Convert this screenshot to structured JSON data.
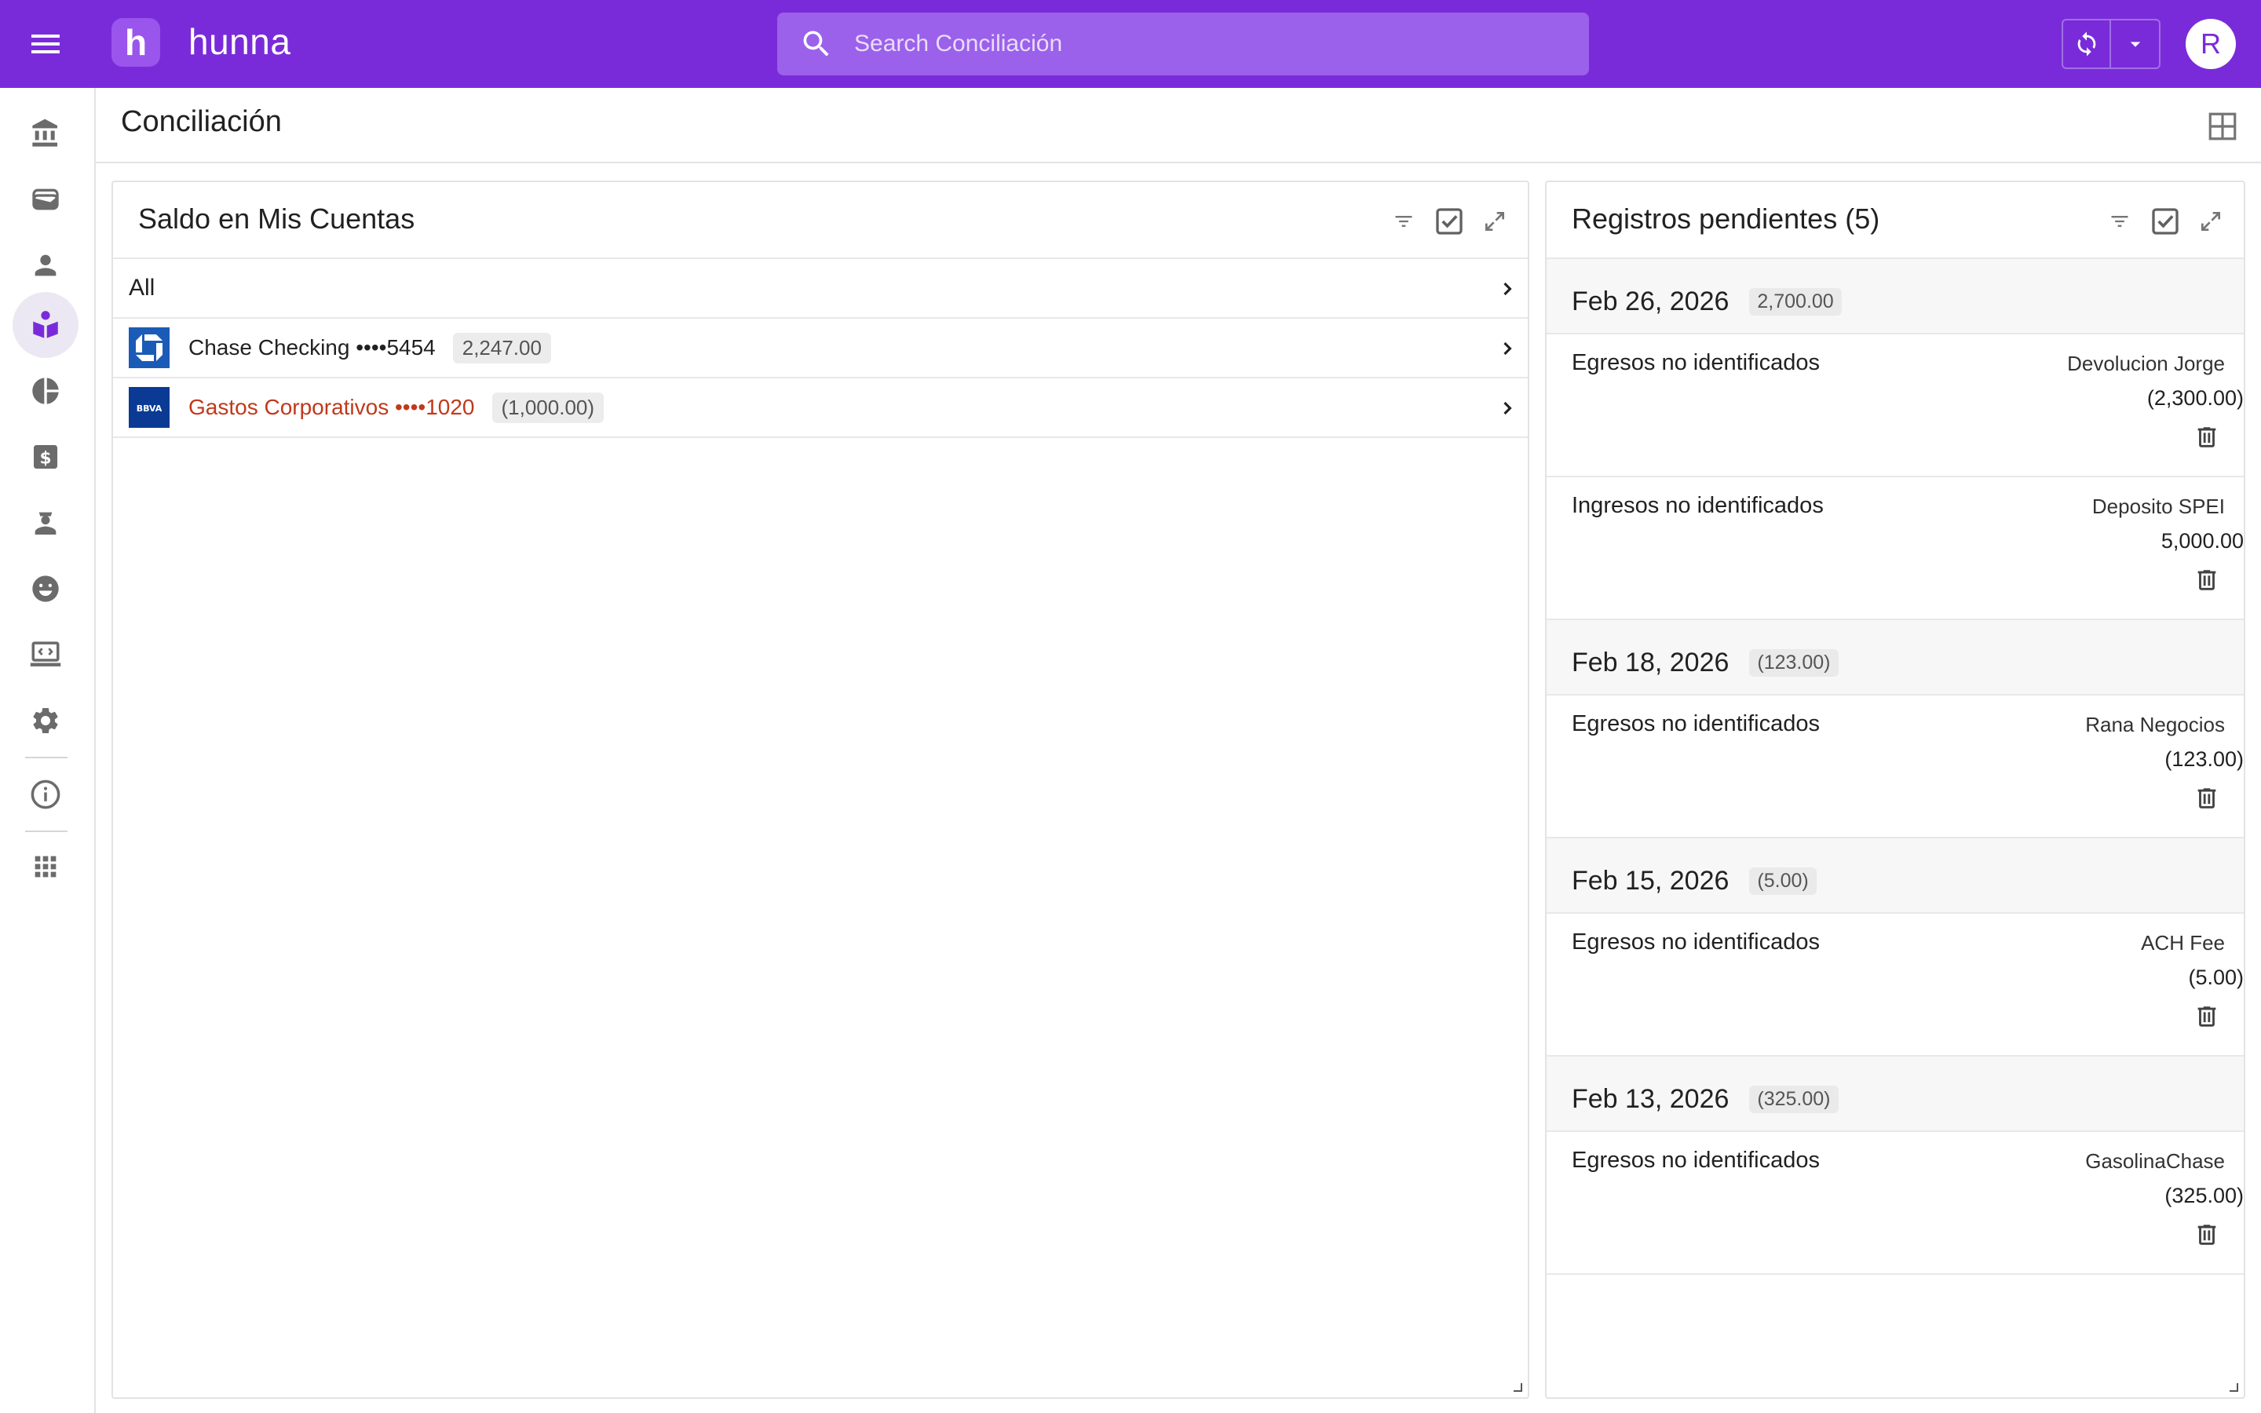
{
  "app": {
    "brand_letter": "h",
    "brand_name": "hunna",
    "avatar_initial": "R",
    "accent": "#7a2bd9"
  },
  "search": {
    "placeholder": "Search Conciliación"
  },
  "page": {
    "title": "Conciliación"
  },
  "nav": {
    "items": [
      {
        "icon": "bank-icon"
      },
      {
        "icon": "wallet-icon"
      },
      {
        "icon": "person-icon"
      },
      {
        "icon": "book-reader-icon",
        "active": true
      },
      {
        "icon": "pie-chart-icon"
      },
      {
        "icon": "dollar-box-icon"
      },
      {
        "icon": "agent-icon"
      },
      {
        "icon": "smiley-icon"
      },
      {
        "icon": "laptop-code-icon"
      },
      {
        "icon": "settings-gear-icon"
      },
      {
        "icon": "info-icon"
      },
      {
        "icon": "apps-grid-icon"
      }
    ]
  },
  "accounts_panel": {
    "title": "Saldo en Mis Cuentas",
    "all_label": "All",
    "accounts": [
      {
        "name": "Chase Checking ••••5454",
        "balance": "2,247.00",
        "negative": false,
        "bank": "chase"
      },
      {
        "name": "Gastos Corporativos ••••1020",
        "balance": "(1,000.00)",
        "negative": true,
        "bank": "bbva",
        "bank_logo_text": "BBVA"
      }
    ]
  },
  "pending_panel": {
    "title": "Registros pendientes (5)",
    "groups": [
      {
        "date": "Feb 26, 2026",
        "total": "2,700.00",
        "records": [
          {
            "type": "Egresos no identificados",
            "description": "Devolucion Jorge",
            "amount": "(2,300.00)"
          },
          {
            "type": "Ingresos no identificados",
            "description": "Deposito SPEI",
            "amount": "5,000.00"
          }
        ]
      },
      {
        "date": "Feb 18, 2026",
        "total": "(123.00)",
        "records": [
          {
            "type": "Egresos no identificados",
            "description": "Rana Negocios",
            "amount": "(123.00)"
          }
        ]
      },
      {
        "date": "Feb 15, 2026",
        "total": "(5.00)",
        "records": [
          {
            "type": "Egresos no identificados",
            "description": "ACH Fee",
            "amount": "(5.00)"
          }
        ]
      },
      {
        "date": "Feb 13, 2026",
        "total": "(325.00)",
        "records": [
          {
            "type": "Egresos no identificados",
            "description": "GasolinaChase",
            "amount": "(325.00)"
          }
        ]
      }
    ]
  }
}
